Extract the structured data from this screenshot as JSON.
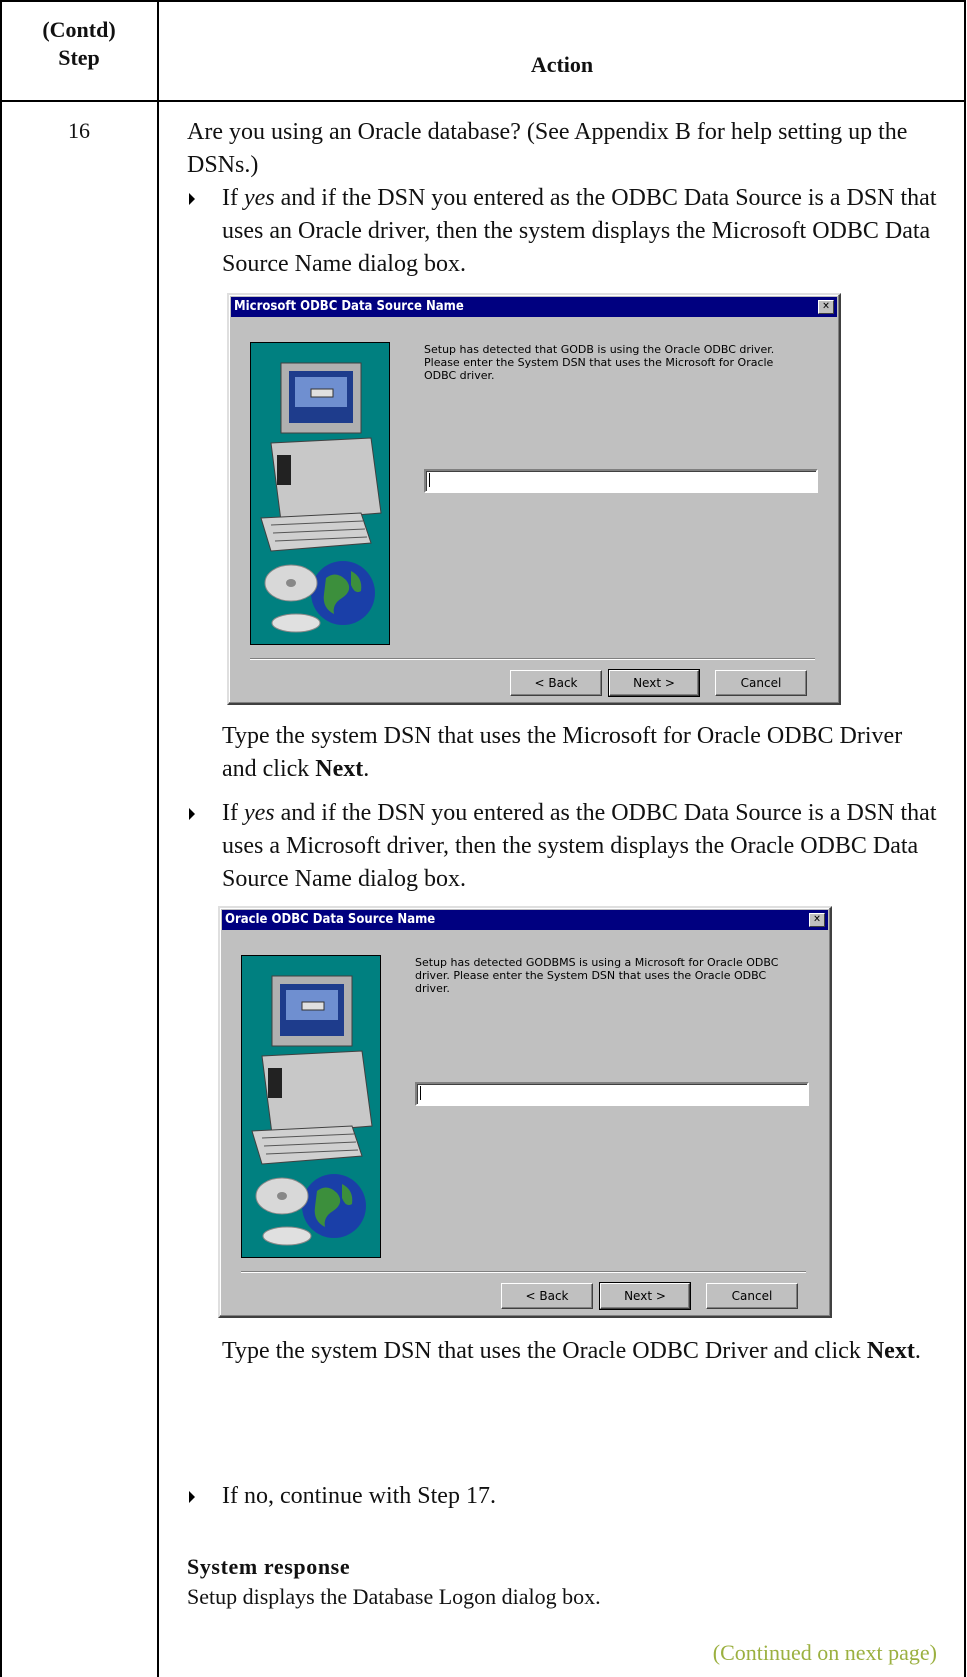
{
  "table": {
    "step_header": "(Contd)\nStep",
    "action_header": "Action",
    "step_number": "16"
  },
  "content": {
    "question": "Are you using an Oracle database? (See Appendix B for help setting up the DSNs.)",
    "bullet1": {
      "yes": "yes",
      "pre": "If ",
      "rest": " and if the DSN you entered as the ODBC Data Source is a DSN that uses an Oracle driver, then the system displays the Microsoft ODBC Data Source Name dialog box."
    },
    "instr1": {
      "text": "Type the system DSN that uses the Microsoft for Oracle ODBC Driver and click ",
      "bold": "Next",
      "end": "."
    },
    "bullet2": {
      "yes": "yes",
      "pre": "If ",
      "rest": " and if the DSN you entered as the ODBC Data Source is a DSN that uses a Microsoft driver, then the system displays the Oracle ODBC Data Source Name dialog box."
    },
    "instr2": {
      "text": "Type the system DSN that uses the Oracle ODBC Driver and click ",
      "bold": "Next",
      "end": "."
    },
    "bullet3": "If no, continue with Step 17.",
    "system_response_label": "System response",
    "system_response_text": "Setup displays the Database Logon dialog box.",
    "continued": "(Continued on next page)"
  },
  "dialog1": {
    "title": "Microsoft ODBC Data Source Name",
    "message": "Setup has detected that GODB is using the Oracle ODBC driver. Please enter the System DSN that uses the  Microsoft for Oracle ODBC driver.",
    "back": "< Back",
    "next": "Next >",
    "cancel": "Cancel"
  },
  "dialog2": {
    "title": "Oracle ODBC Data Source Name",
    "message": "Setup has detected GODBMS is using a Microsoft for Oracle ODBC driver. Please enter the System DSN that uses the Oracle ODBC driver.",
    "back": "< Back",
    "next": "Next >",
    "cancel": "Cancel"
  },
  "colors": {
    "titlebar": "#000080",
    "dialog_face": "#c0c0c0",
    "art_background": "#008080",
    "continued_text": "#9bb040"
  }
}
